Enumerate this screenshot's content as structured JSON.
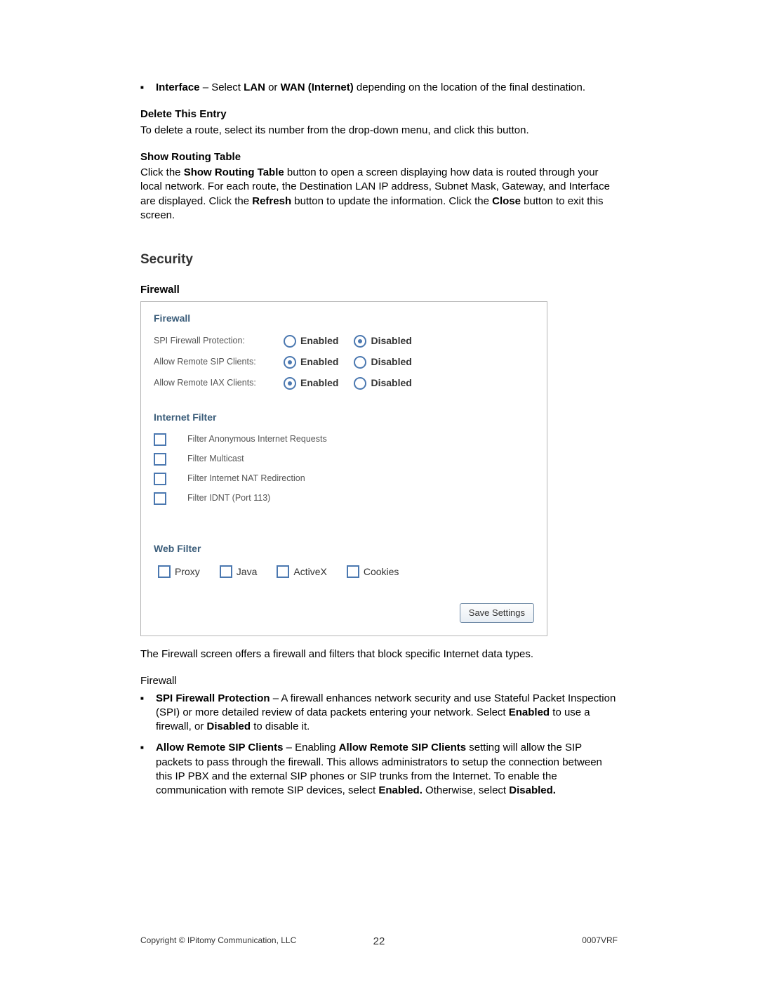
{
  "interface_bullet": {
    "lead": "Interface",
    "text_1": " – Select ",
    "bold_1": "LAN",
    "text_2": " or ",
    "bold_2": "WAN (Internet)",
    "text_3": " depending on the location of the final destination."
  },
  "delete_entry": {
    "heading": "Delete This Entry",
    "text": "To delete a route, select its number from the drop-down menu, and click this button."
  },
  "show_routing": {
    "heading": "Show Routing Table",
    "text_1": "Click the ",
    "bold_1": "Show Routing Table",
    "text_2": " button to open a screen displaying how data is routed through your local network. For each route, the Destination LAN IP address, Subnet Mask, Gateway, and Interface are displayed. Click the ",
    "bold_2": "Refresh",
    "text_3": " button to update the information. Click the ",
    "bold_3": "Close",
    "text_4": " button to exit this screen."
  },
  "security_heading": "Security",
  "firewall_heading": "Firewall",
  "panel": {
    "firewall": {
      "title": "Firewall",
      "rows": {
        "spi": {
          "label": "SPI Firewall Protection:",
          "enabled": "Enabled",
          "disabled": "Disabled",
          "value": "disabled"
        },
        "sip": {
          "label": "Allow Remote SIP Clients:",
          "enabled": "Enabled",
          "disabled": "Disabled",
          "value": "enabled"
        },
        "iax": {
          "label": "Allow Remote IAX Clients:",
          "enabled": "Enabled",
          "disabled": "Disabled",
          "value": "enabled"
        }
      }
    },
    "internet_filter": {
      "title": "Internet Filter",
      "items": {
        "anon": "Filter Anonymous Internet Requests",
        "multicast": "Filter Multicast",
        "nat": "Filter Internet NAT Redirection",
        "idnt": "Filter IDNT (Port 113)"
      }
    },
    "web_filter": {
      "title": "Web Filter",
      "items": {
        "proxy": "Proxy",
        "java": "Java",
        "activex": "ActiveX",
        "cookies": "Cookies"
      }
    },
    "save_button": "Save Settings"
  },
  "after_panel": "The Firewall screen offers a firewall and filters that block specific Internet data types.",
  "firewall_sub": "Firewall",
  "spi_bullet": {
    "lead": "SPI Firewall Protection",
    "text_1": " – A firewall enhances network security and use Stateful Packet Inspection (SPI) or more detailed review of data packets entering your network. Select ",
    "bold_1": "Enabled",
    "text_2": " to use a firewall, or ",
    "bold_2": "Disabled",
    "text_3": " to disable it."
  },
  "sip_bullet": {
    "lead": "Allow Remote SIP Clients",
    "text_1": " – Enabling ",
    "bold_1": "Allow Remote SIP Clients",
    "text_2": " setting will allow the SIP packets to pass through the firewall. This allows administrators to setup the connection between this IP PBX and the external SIP phones or SIP trunks from the Internet. To enable the communication with remote SIP devices, select ",
    "bold_2": "Enabled.",
    "text_3": " Otherwise, select ",
    "bold_3": "Disabled."
  },
  "footer": {
    "left": "Copyright © IPitomy Communication, LLC",
    "center": "22",
    "right": "0007VRF"
  }
}
